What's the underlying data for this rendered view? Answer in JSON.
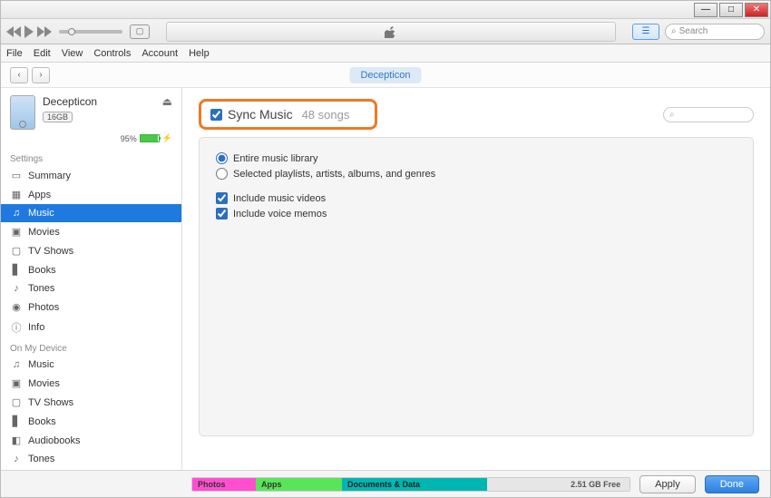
{
  "window": {
    "minimize": "—",
    "maximize": "□",
    "close": "✕"
  },
  "toolbar": {
    "search_placeholder": "Search"
  },
  "menubar": [
    "File",
    "Edit",
    "View",
    "Controls",
    "Account",
    "Help"
  ],
  "header": {
    "device_tab": "Decepticon"
  },
  "device": {
    "name": "Decepticon",
    "capacity": "16GB",
    "battery_pct": "95%"
  },
  "sidebar": {
    "settings_label": "Settings",
    "on_device_label": "On My Device",
    "settings": [
      {
        "icon": "▭",
        "label": "Summary"
      },
      {
        "icon": "▦",
        "label": "Apps"
      },
      {
        "icon": "♫",
        "label": "Music"
      },
      {
        "icon": "▣",
        "label": "Movies"
      },
      {
        "icon": "▢",
        "label": "TV Shows"
      },
      {
        "icon": "▋",
        "label": "Books"
      },
      {
        "icon": "♪",
        "label": "Tones"
      },
      {
        "icon": "◉",
        "label": "Photos"
      },
      {
        "icon": "ⓘ",
        "label": "Info"
      }
    ],
    "ondevice": [
      {
        "icon": "♫",
        "label": "Music"
      },
      {
        "icon": "▣",
        "label": "Movies"
      },
      {
        "icon": "▢",
        "label": "TV Shows"
      },
      {
        "icon": "▋",
        "label": "Books"
      },
      {
        "icon": "◧",
        "label": "Audiobooks"
      },
      {
        "icon": "♪",
        "label": "Tones"
      }
    ]
  },
  "main": {
    "sync_label": "Sync Music",
    "song_count": "48 songs",
    "opt_entire": "Entire music library",
    "opt_selected": "Selected playlists, artists, albums, and genres",
    "opt_videos": "Include music videos",
    "opt_memos": "Include voice memos"
  },
  "bottom": {
    "photos": "Photos",
    "apps": "Apps",
    "docs": "Documents & Data",
    "free": "2.51 GB Free",
    "apply": "Apply",
    "done": "Done"
  }
}
